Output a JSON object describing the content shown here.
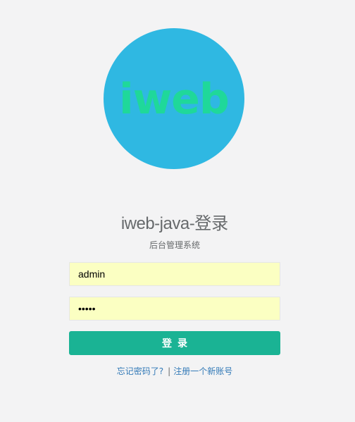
{
  "logo": {
    "text": "iweb",
    "circle_color": "#2fb8e2",
    "text_color": "#1fd89a"
  },
  "title": {
    "latin": "iweb-java-",
    "cjk": "登录"
  },
  "subtitle": "后台管理系统",
  "form": {
    "username_value": "admin",
    "password_value": "•••••"
  },
  "login_button": {
    "label": "登录",
    "color": "#1ab394"
  },
  "links": {
    "forgot": "忘记密码了?",
    "separator": "|",
    "register": "注册一个新账号"
  }
}
